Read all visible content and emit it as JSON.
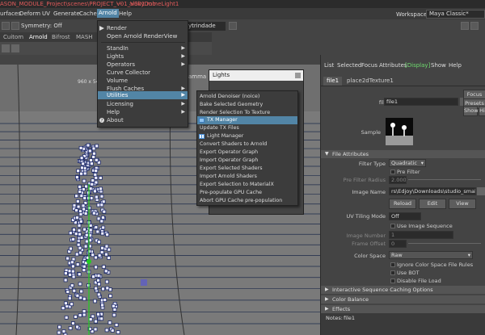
{
  "titlebar": {
    "project": "ASON_MODULE_Project\\scenes\\PROJECT_V01_V001.mb",
    "separator": "---",
    "object": "aiSkyDomeLight1"
  },
  "menubar": {
    "items": [
      "urfaces",
      "Deform",
      "UV",
      "Generate",
      "Cache",
      "Arnold",
      "Help"
    ],
    "workspace_label": "Workspace :",
    "workspace_value": "Maya Classic*"
  },
  "toolbar": {
    "symmetry": "Symmetry: Off",
    "dome_field": "ytrindade"
  },
  "shelf": {
    "tabs": [
      "Cuitom",
      "Arnold",
      "Bifrost",
      "MASH"
    ]
  },
  "viewport": {
    "res_gate": "960 x 54",
    "gamma": "amma",
    "lights_title": "Lights"
  },
  "arnold_menu": {
    "items": [
      {
        "label": "Render",
        "icon": "render-icon",
        "arrow": false
      },
      {
        "label": "Open Arnold RenderView",
        "icon": "",
        "arrow": false
      },
      {
        "label": "StandIn",
        "icon": "",
        "arrow": true
      },
      {
        "label": "Lights",
        "icon": "",
        "arrow": true
      },
      {
        "label": "Operators",
        "icon": "",
        "arrow": true
      },
      {
        "label": "Curve Collector",
        "icon": "",
        "arrow": false
      },
      {
        "label": "Volume",
        "icon": "",
        "arrow": false
      },
      {
        "label": "Flush Caches",
        "icon": "",
        "arrow": true
      },
      {
        "label": "Utilities",
        "icon": "",
        "arrow": true
      },
      {
        "label": "Licensing",
        "icon": "",
        "arrow": true
      },
      {
        "label": "Help",
        "icon": "",
        "arrow": true
      },
      {
        "label": "About",
        "icon": "help-icon",
        "arrow": false
      }
    ]
  },
  "utilities_menu": {
    "items": [
      {
        "label": "Arnold Denoiser (noice)",
        "icon": ""
      },
      {
        "label": "Bake Selected Geometry",
        "icon": ""
      },
      {
        "label": "Render Selection To Texture",
        "icon": ""
      },
      {
        "label": "TX Manager",
        "icon": "tx-manager-icon"
      },
      {
        "label": "Update TX Files",
        "icon": ""
      },
      {
        "label": "Light Manager",
        "icon": "light-manager-icon"
      },
      {
        "label": "Convert Shaders to Arnold",
        "icon": ""
      },
      {
        "label": "Export Operator Graph",
        "icon": ""
      },
      {
        "label": "Import Operator Graph",
        "icon": ""
      },
      {
        "label": "Export Selected Shaders",
        "icon": ""
      },
      {
        "label": "Import Arnold Shaders",
        "icon": ""
      },
      {
        "label": "Export Selection to MaterialX",
        "icon": ""
      },
      {
        "label": "Pre-populate GPU Cache",
        "icon": ""
      },
      {
        "label": "Abort GPU Cache pre-population",
        "icon": ""
      }
    ]
  },
  "attr_editor": {
    "menu": [
      "List",
      "Selected",
      "Focus",
      "Attributes",
      "Display",
      "Show",
      "Help"
    ],
    "tabs": [
      "file1",
      "place2dTexture1"
    ],
    "file_label": "file:",
    "file_value": "file1",
    "focus_btn": "Focus",
    "presets_btn": "Presets",
    "show_btn": "Show",
    "hide_btn": "Hi",
    "sample_label": "Sample",
    "section_file_attributes": "File Attributes",
    "filter_type_label": "Filter Type",
    "filter_type_value": "Quadratic",
    "pre_filter_label": "Pre Filter",
    "pre_filter_radius_label": "Pre Filter Radius",
    "pre_filter_radius_value": "2.000",
    "image_name_label": "Image Name",
    "image_name_value": "rs\\Edjoy\\Downloads\\studio_small_03_1k.hdr",
    "reload_btn": "Reload",
    "edit_btn": "Edit",
    "view_btn": "View",
    "uv_tiling_label": "UV Tiling Mode",
    "uv_tiling_value": "Off",
    "use_image_seq_label": "Use Image Sequence",
    "image_number_label": "Image Number",
    "image_number_value": "1",
    "frame_offset_label": "Frame Offset",
    "frame_offset_value": "0",
    "color_space_label": "Color Space",
    "color_space_value": "Raw",
    "ignore_cs_label": "Ignore Color Space File Rules",
    "use_bot_label": "Use BOT",
    "disable_file_load_label": "Disable File Load",
    "section_interactive": "Interactive Sequence Caching Options",
    "section_color_balance": "Color Balance",
    "section_effects": "Effects",
    "notes_label": "Notes:",
    "notes_value": "file1"
  },
  "colors": {
    "accent": "#5285a6",
    "display_green": "#6fdc6f",
    "title_red": "#e05a5a"
  }
}
